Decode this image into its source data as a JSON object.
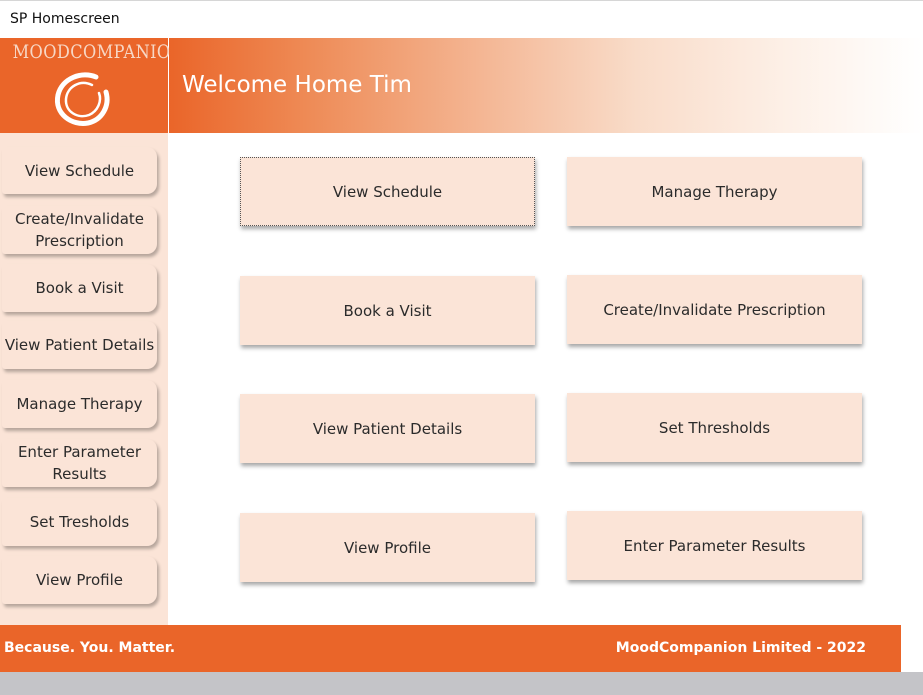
{
  "window": {
    "title": "SP Homescreen"
  },
  "brand": {
    "logo_text": "MOODCOMPANION",
    "logo_icon": "ring-logo-icon",
    "accent_color": "#ea6529",
    "button_color": "#fbe4d7"
  },
  "header": {
    "title": "Welcome Home Tim"
  },
  "sidebar": {
    "items": [
      {
        "label": "View Schedule"
      },
      {
        "label": "Create/Invalidate Prescription"
      },
      {
        "label": "Book a Visit"
      },
      {
        "label": "View Patient Details"
      },
      {
        "label": "Manage Therapy"
      },
      {
        "label": "Enter Parameter Results"
      },
      {
        "label": "Set Tresholds"
      },
      {
        "label": "View Profile"
      }
    ]
  },
  "main": {
    "buttons": [
      {
        "label": "View Schedule",
        "focused": true
      },
      {
        "label": "Manage Therapy"
      },
      {
        "label": "Book a Visit"
      },
      {
        "label": "Create/Invalidate Prescription"
      },
      {
        "label": "View Patient Details"
      },
      {
        "label": "Set Thresholds"
      },
      {
        "label": "View Profile"
      },
      {
        "label": "Enter Parameter Results"
      }
    ]
  },
  "footer": {
    "tagline": "Because. You. Matter.",
    "copyright": "MoodCompanion Limited - 2022"
  }
}
